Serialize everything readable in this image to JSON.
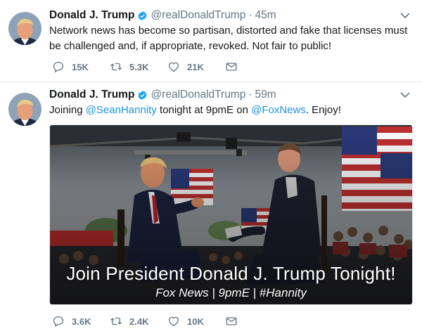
{
  "tweets": [
    {
      "name": "Donald J. Trump",
      "handle": "@realDonaldTrump",
      "separator": "·",
      "time": "45m",
      "text": "Network news has become so partisan, distorted and fake that licenses must be challenged and, if appropriate, revoked. Not fair to public!",
      "replies": "15K",
      "retweets": "5.3K",
      "likes": "21K"
    },
    {
      "name": "Donald J. Trump",
      "handle": "@realDonaldTrump",
      "separator": "·",
      "time": "59m",
      "text_parts": {
        "prefix": "Joining ",
        "mention1": "@SeanHannity",
        "middle": " tonight at 9pmE on ",
        "mention2": "@FoxNews",
        "suffix": ". Enjoy!"
      },
      "media": {
        "title": "Join President Donald J. Trump Tonight!",
        "subtitle": "Fox News | 9pmE | #Hannity"
      },
      "replies": "3.6K",
      "retweets": "2.4K",
      "likes": "10K"
    }
  ],
  "colors": {
    "text": "#14171a",
    "secondary": "#657786",
    "link": "#1b95e0",
    "verified": "#1da1f2",
    "divider": "#e6ecf0"
  },
  "icons": {
    "reply": "reply-icon",
    "retweet": "retweet-icon",
    "like": "heart-icon",
    "dm": "envelope-icon",
    "verified": "verified-badge-icon",
    "caret": "chevron-down-icon"
  }
}
